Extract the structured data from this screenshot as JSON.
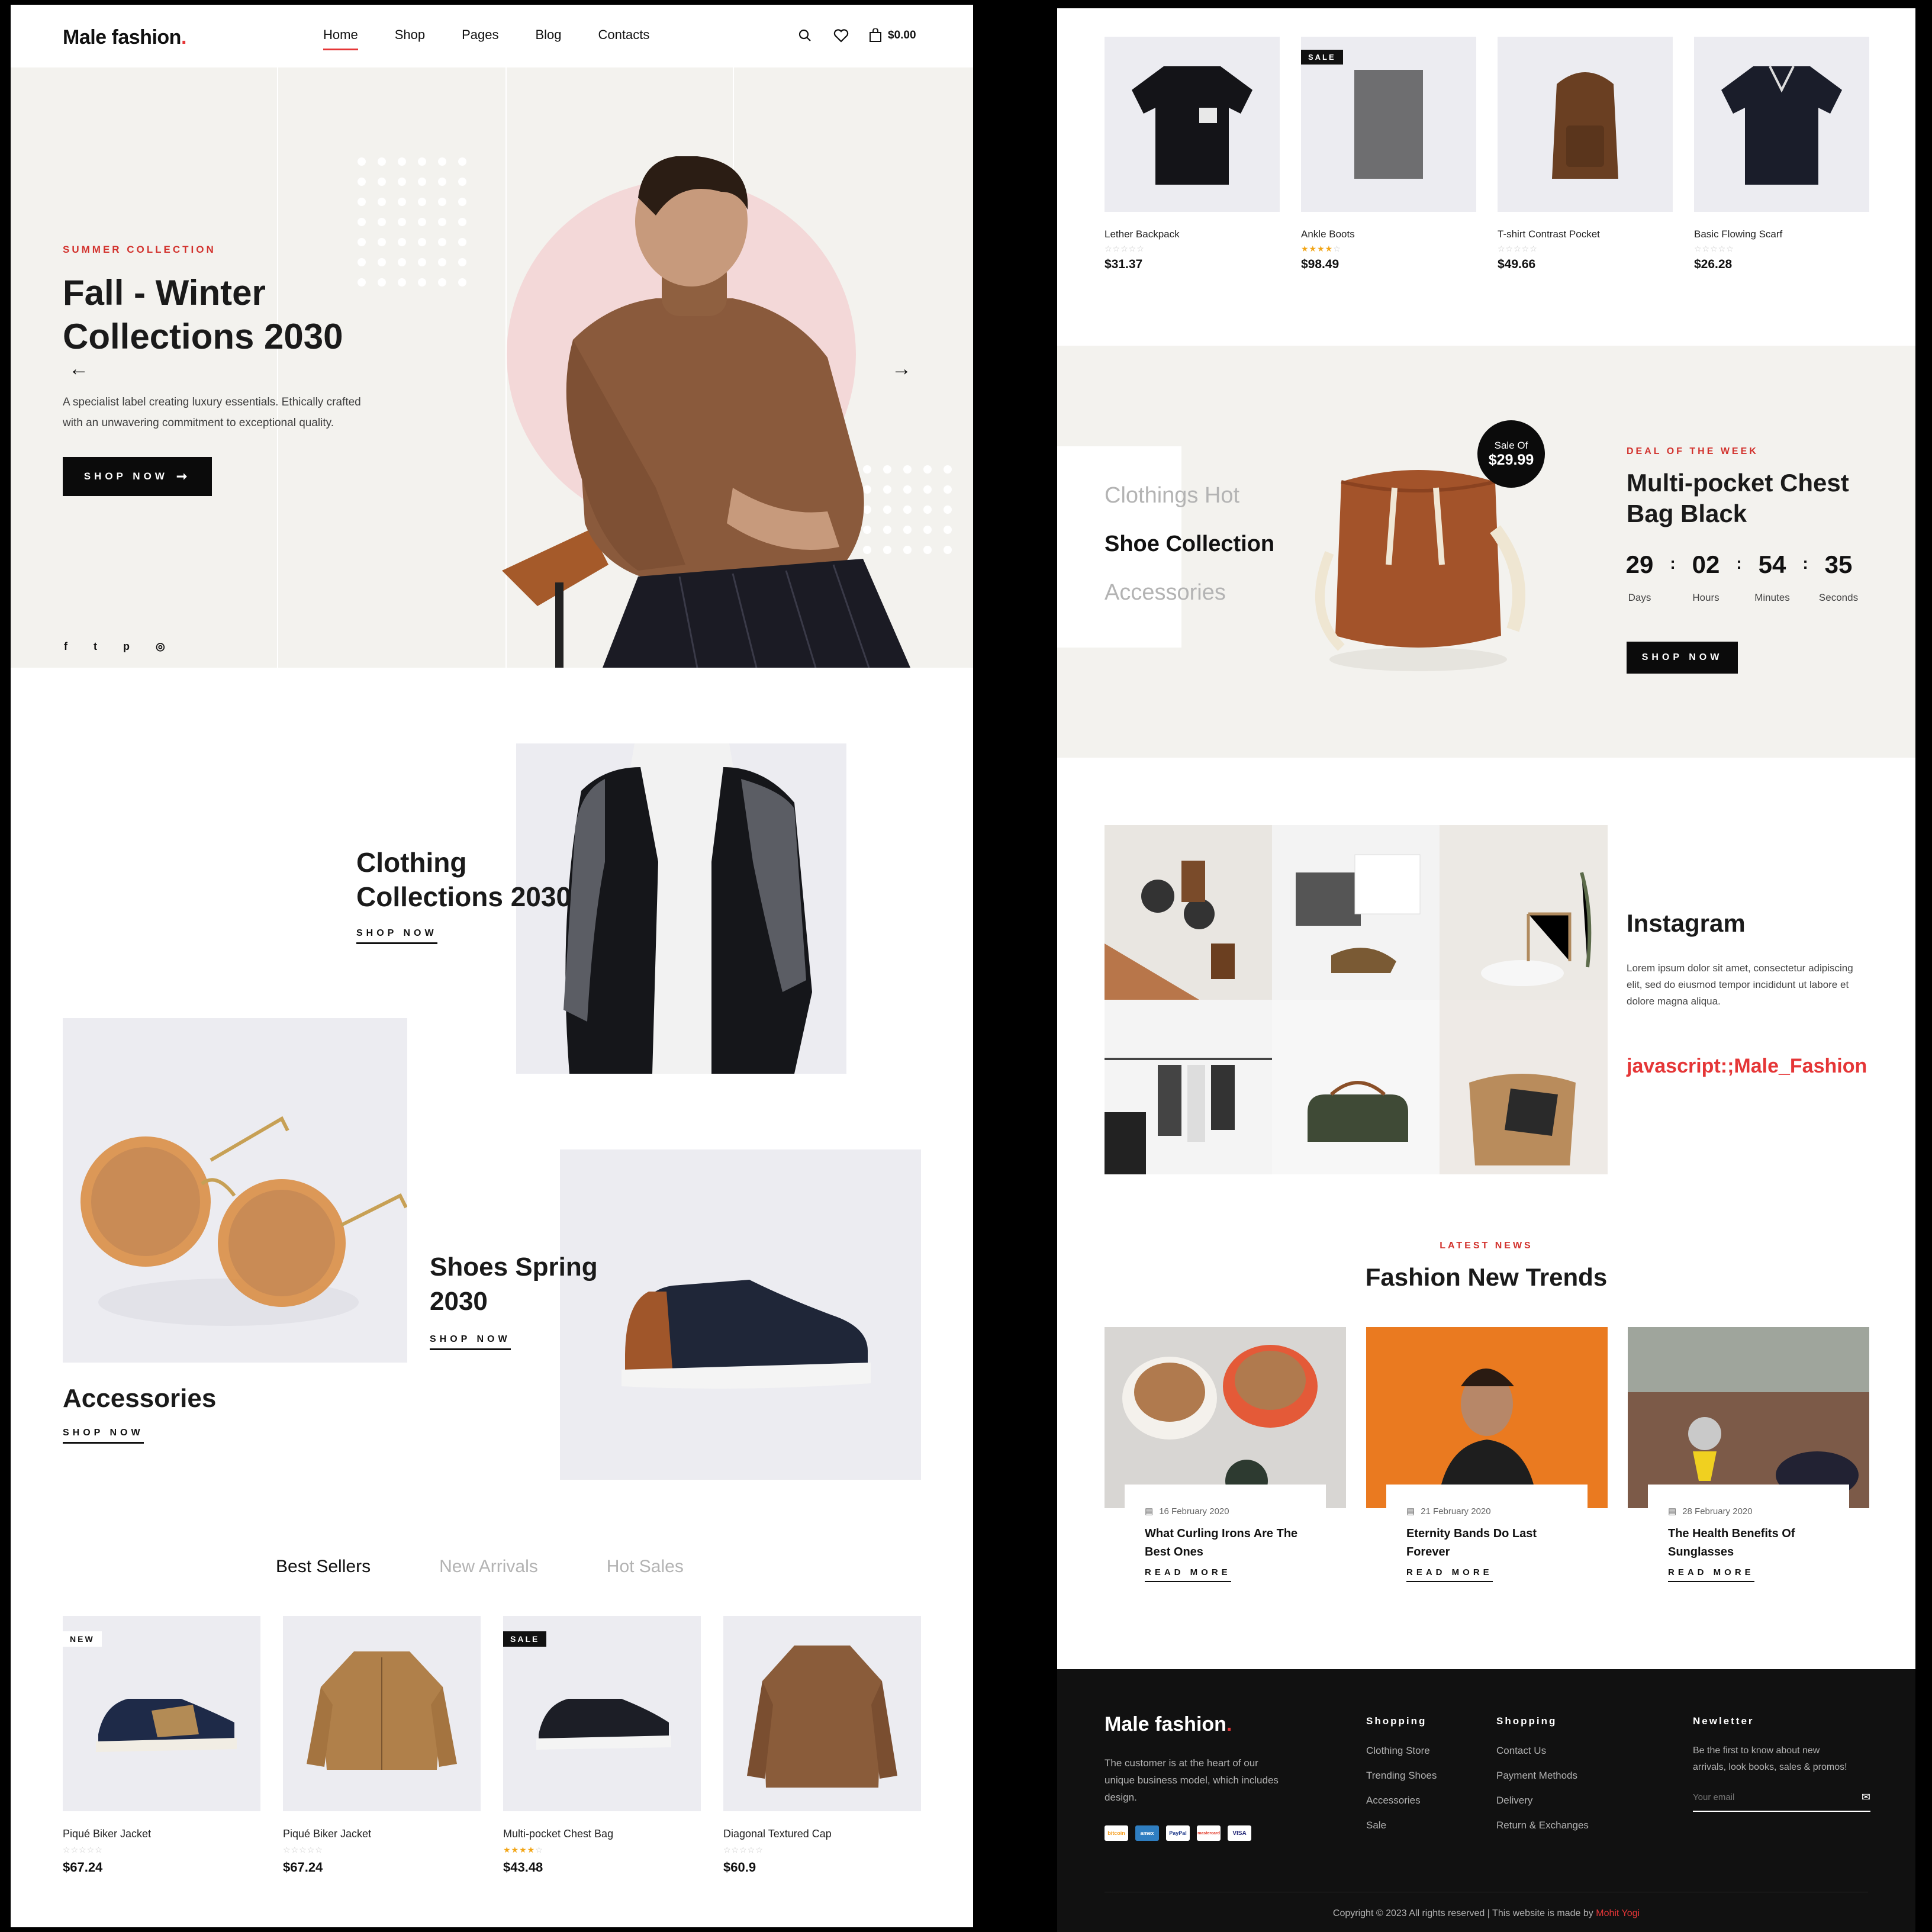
{
  "brand": {
    "name": "Male fashion",
    "dot": "."
  },
  "nav": {
    "items": [
      "Home",
      "Shop",
      "Pages",
      "Blog",
      "Contacts"
    ],
    "cart_total": "$0.00"
  },
  "hero": {
    "tag": "Summer Collection",
    "title_line1": "Fall - Winter",
    "title_line2": "Collections 2030",
    "desc_line1": "A specialist label creating luxury essentials. Ethically crafted",
    "desc_line2": "with an unwavering commitment to exceptional quality.",
    "button": "Shop now"
  },
  "banners": {
    "clothing": {
      "line1": "Clothing",
      "line2": "Collections 2030",
      "link": "Shop now"
    },
    "accessories": {
      "title": "Accessories",
      "link": "Shop now"
    },
    "shoes": {
      "line1": "Shoes Spring",
      "line2": "2030",
      "link": "Shop now"
    }
  },
  "product_tabs": [
    "Best Sellers",
    "New Arrivals",
    "Hot Sales"
  ],
  "products_left": [
    {
      "name": "Piqué Biker Jacket",
      "price": "$67.24",
      "badge": "NEW",
      "rating": 0
    },
    {
      "name": "Piqué Biker Jacket",
      "price": "$67.24",
      "badge": "",
      "rating": 0
    },
    {
      "name": "Multi-pocket Chest Bag",
      "price": "$43.48",
      "badge": "SALE",
      "rating": 4
    },
    {
      "name": "Diagonal Textured Cap",
      "price": "$60.9",
      "badge": "",
      "rating": 0
    }
  ],
  "products_right": [
    {
      "name": "Lether Backpack",
      "price": "$31.37",
      "badge": "",
      "rating": 0
    },
    {
      "name": "Ankle Boots",
      "price": "$98.49",
      "badge": "SALE",
      "rating": 4
    },
    {
      "name": "T-shirt Contrast Pocket",
      "price": "$49.66",
      "badge": "",
      "rating": 0
    },
    {
      "name": "Basic Flowing Scarf",
      "price": "$26.28",
      "badge": "",
      "rating": 0
    }
  ],
  "deal": {
    "categories": [
      "Clothings Hot",
      "Shoe Collection",
      "Accessories"
    ],
    "sale_label": "Sale Of",
    "sale_price": "$29.99",
    "tag": "Deal of the week",
    "title_line1": "Multi-pocket Chest",
    "title_line2": "Bag Black",
    "countdown": [
      {
        "value": "29",
        "unit": "Days"
      },
      {
        "value": "02",
        "unit": "Hours"
      },
      {
        "value": "54",
        "unit": "Minutes"
      },
      {
        "value": "35",
        "unit": "Seconds"
      }
    ],
    "separator": ":",
    "button": "Shop now"
  },
  "instagram": {
    "title": "Instagram",
    "text_line1": "Lorem ipsum dolor sit amet, consectetur adipiscing",
    "text_line2": "elit, sed do eiusmod tempor incididunt ut labore et",
    "text_line3": "dolore magna aliqua.",
    "handle": "javascript:;Male_Fashion"
  },
  "news": {
    "tag": "Latest News",
    "title": "Fashion New Trends",
    "posts": [
      {
        "date": "16 February 2020",
        "title_line1": "What Curling Irons Are The",
        "title_line2": "Best Ones",
        "link": "Read more"
      },
      {
        "date": "21 February 2020",
        "title_line1": "Eternity Bands Do Last",
        "title_line2": "Forever",
        "link": "Read more"
      },
      {
        "date": "28 February 2020",
        "title_line1": "The Health Benefits Of",
        "title_line2": "Sunglasses",
        "link": "Read more"
      }
    ]
  },
  "footer": {
    "about_line1": "The customer is at the heart of our",
    "about_line2": "unique business model, which includes",
    "about_line3": "design.",
    "payments": [
      "bitcoin",
      "amex",
      "PayPal",
      "mastercard",
      "VISA"
    ],
    "col1": {
      "title": "Shopping",
      "links": [
        "Clothing Store",
        "Trending Shoes",
        "Accessories",
        "Sale"
      ]
    },
    "col2": {
      "title": "Shopping",
      "links": [
        "Contact Us",
        "Payment Methods",
        "Delivery",
        "Return & Exchanges"
      ]
    },
    "newsletter": {
      "title": "Newletter",
      "text_line1": "Be the first to know about new",
      "text_line2": "arrivals, look books, sales & promos!",
      "placeholder": "Your email"
    },
    "copyright": "Copyright © 2023 All rights reserved | This website is made by",
    "author": "Mohit Yogi"
  },
  "colors": {
    "accent": "#e53637",
    "dark": "#111111",
    "hero_bg": "#f3f2ee",
    "product_bg": "#ececf1",
    "footer_bg": "#111111"
  }
}
